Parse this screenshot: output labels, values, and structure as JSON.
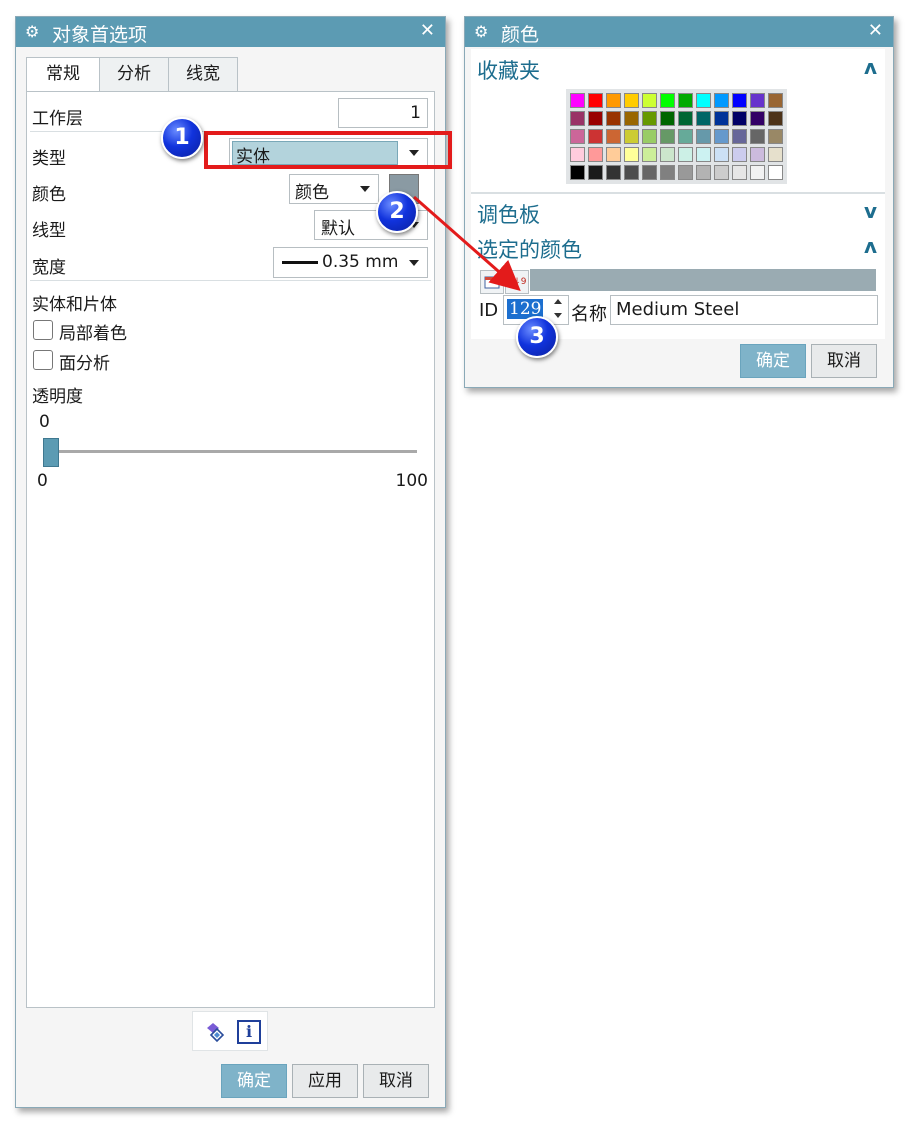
{
  "left_dialog": {
    "title": "对象首选项",
    "close_glyph": "✕",
    "tabs": [
      {
        "label": "常规",
        "active": true
      },
      {
        "label": "分析",
        "active": false
      },
      {
        "label": "线宽",
        "active": false
      }
    ],
    "work_layer": {
      "label": "工作层",
      "value": "1"
    },
    "type": {
      "label": "类型",
      "value": "实体"
    },
    "color": {
      "label": "颜色",
      "mode_value": "颜色",
      "swatch_color": "#8a9aa3"
    },
    "line_type": {
      "label": "线型",
      "value": "默认"
    },
    "width": {
      "label": "宽度",
      "value": "0.35 mm"
    },
    "solid_section": {
      "title": "实体和片体",
      "partial_shading": {
        "label": "局部着色",
        "checked": false
      },
      "face_analysis": {
        "label": "面分析",
        "checked": false
      }
    },
    "transparency": {
      "label": "透明度",
      "current": "0",
      "min": "0",
      "max": "100",
      "level": 0
    },
    "footer_icons": [
      "layer-edit-icon",
      "info-icon"
    ],
    "info_glyph": "i",
    "buttons": {
      "ok": "确定",
      "apply": "应用",
      "cancel": "取消"
    }
  },
  "right_dialog": {
    "title": "颜色",
    "close_glyph": "✕",
    "favorites": {
      "label": "收藏夹",
      "expanded": true,
      "chevron": "ʌ"
    },
    "palette": {
      "label": "调色板",
      "expanded": false,
      "chevron": "v"
    },
    "selected": {
      "label": "选定的颜色",
      "expanded": true,
      "chevron": "ʌ",
      "bar_color": "#9aabb2"
    },
    "sort_glyph": "1↓9",
    "id": {
      "label": "ID",
      "value": "129"
    },
    "name": {
      "label": "名称",
      "value": "Medium Steel"
    },
    "buttons": {
      "ok": "确定",
      "cancel": "取消"
    },
    "swatch_colors": [
      [
        "#ff00ff",
        "#ff0000",
        "#ff9900",
        "#ffcc00",
        "#ccff33",
        "#00ff00",
        "#00aa00",
        "#00ffff",
        "#0099ff",
        "#0000ff",
        "#6633cc",
        "#996633"
      ],
      [
        "#993366",
        "#990000",
        "#993300",
        "#996600",
        "#669900",
        "#006600",
        "#006633",
        "#006666",
        "#003399",
        "#000066",
        "#330066",
        "#4d3319"
      ],
      [
        "#cc6699",
        "#cc3333",
        "#cc6633",
        "#cccc33",
        "#99cc66",
        "#669966",
        "#66aa99",
        "#6699aa",
        "#6699cc",
        "#666699",
        "#666666",
        "#998866"
      ],
      [
        "#ffccdd",
        "#ff9999",
        "#ffcc99",
        "#ffff99",
        "#ccee99",
        "#cce6cc",
        "#ccf0e6",
        "#ccf2f2",
        "#cce0f5",
        "#ccccee",
        "#ccbbdd",
        "#e6e0cc"
      ],
      [
        "#000000",
        "#1a1a1a",
        "#333333",
        "#4d4d4d",
        "#666666",
        "#808080",
        "#999999",
        "#b3b3b3",
        "#cccccc",
        "#e6e6e6",
        "#f2f2f2",
        "#ffffff"
      ]
    ]
  },
  "annotations": {
    "badges": [
      "1",
      "2",
      "3"
    ],
    "highlight_color": "#e31b1b",
    "arrow_color": "#e31b1b"
  }
}
